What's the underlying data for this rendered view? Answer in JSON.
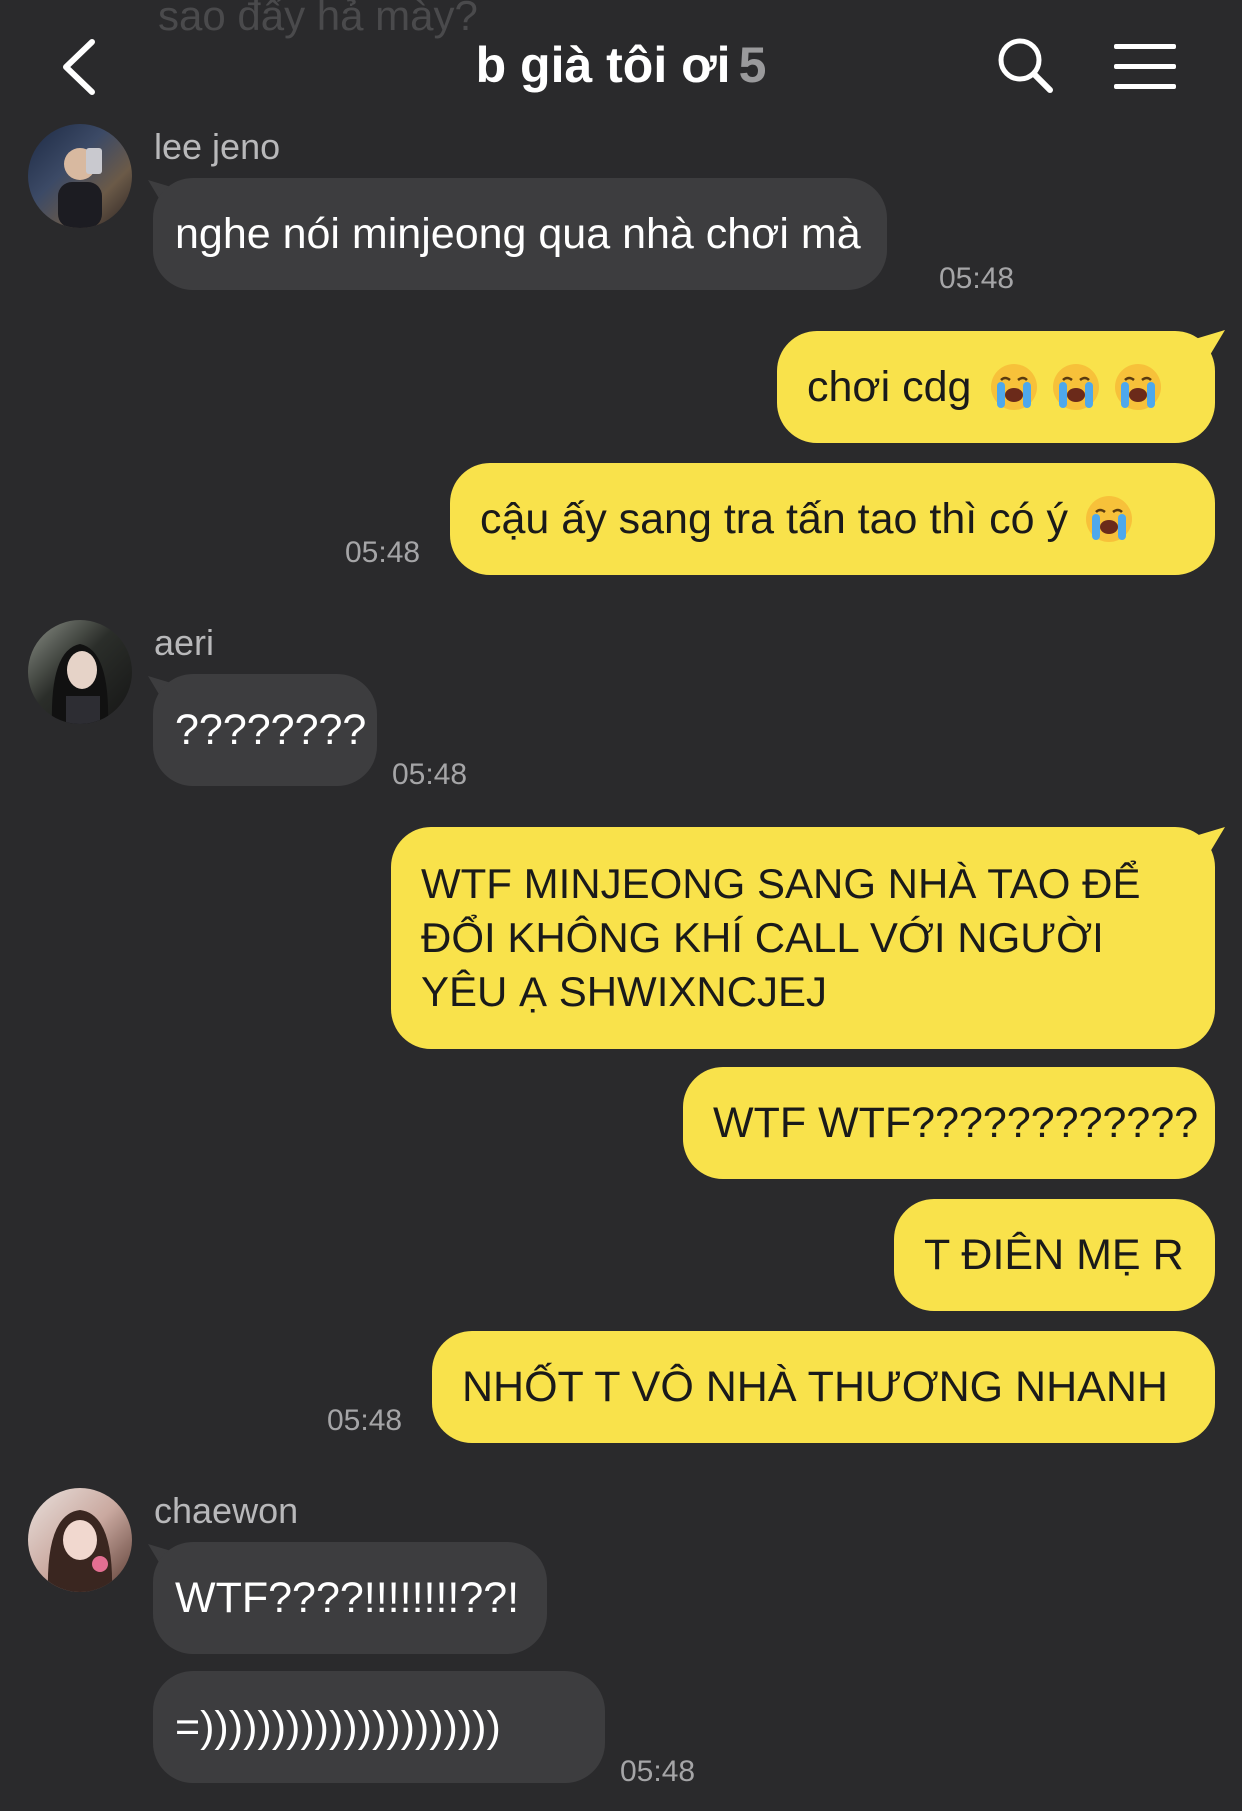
{
  "header": {
    "ghost_text": "sao đấy hả mày?",
    "title": "b già tôi ơi",
    "member_count": "5"
  },
  "messages": {
    "jeno_name": "lee jeno",
    "jeno_msg": "nghe nói minjeong qua nhà chơi mà",
    "jeno_time": "05:48",
    "me1": "chơi cdg",
    "me2": "cậu ấy sang tra tấn tao thì có ý",
    "me2_time": "05:48",
    "aeri_name": "aeri",
    "aeri_msg": "????????",
    "aeri_time": "05:48",
    "me3": "WTF MINJEONG SANG NHÀ TAO ĐỂ ĐỔI KHÔNG KHÍ CALL VỚI NGƯỜI YÊU Ạ SHWIXNCJEJ",
    "me4": "WTF WTF????????????",
    "me5": "T ĐIÊN MẸ R",
    "me6": "NHỐT T VÔ NHÀ THƯƠNG NHANH",
    "me6_time": "05:48",
    "chaewon_name": "chaewon",
    "chaewon_msg1": "WTF????!!!!!!!!??!",
    "chaewon_msg2": "=)))))))))))))))))))))",
    "chaewon_time": "05:48"
  },
  "icons": {
    "back": "chevron-left-icon",
    "search": "search-icon",
    "menu": "hamburger-menu-icon",
    "emoji": "loudly-crying-face"
  },
  "colors": {
    "background": "#2a2a2c",
    "incoming_bubble": "#3d3d3f",
    "outgoing_bubble": "#f9e24b"
  }
}
